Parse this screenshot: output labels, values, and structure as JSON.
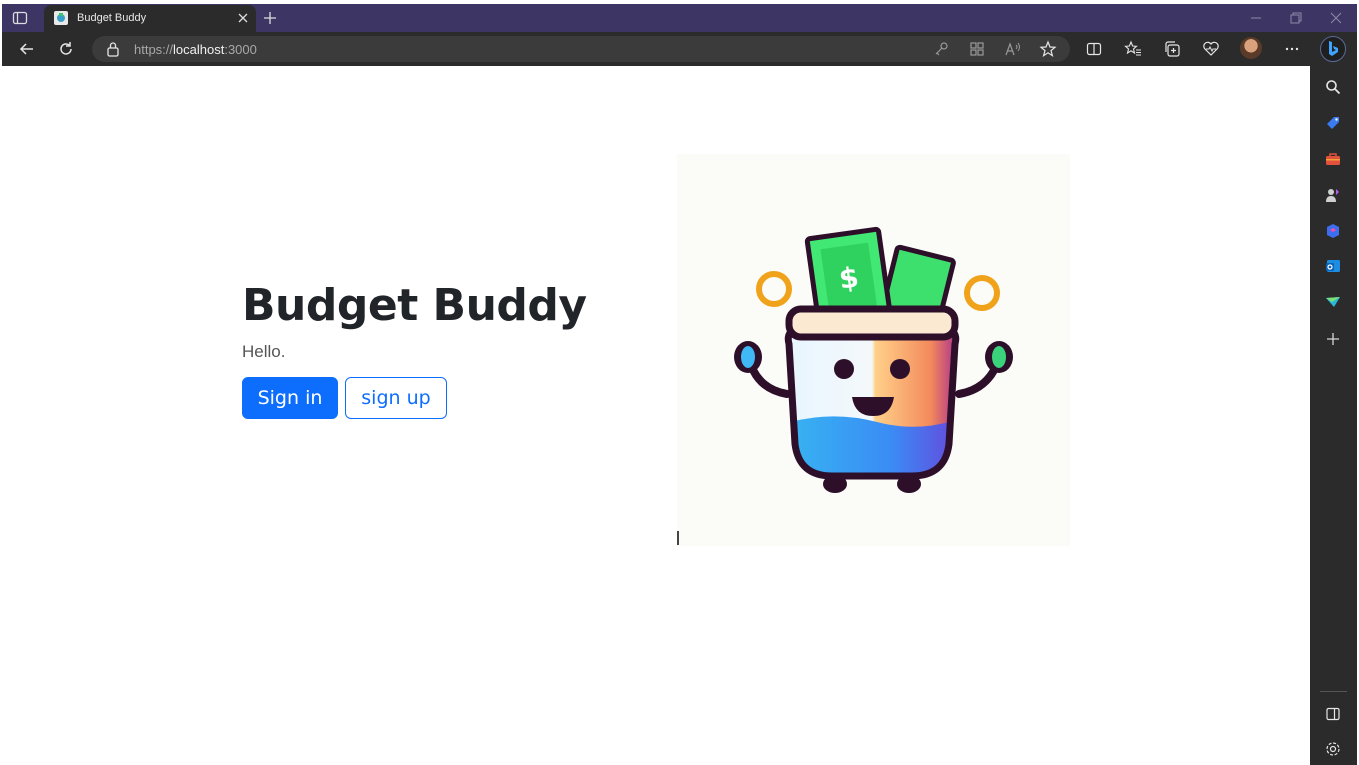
{
  "browser": {
    "tab_title": "Budget Buddy",
    "url_scheme": "https://",
    "url_host": "localhost",
    "url_port": ":3000",
    "theme_color": "#3d3564"
  },
  "page": {
    "title": "Budget Buddy",
    "greeting": "Hello.",
    "sign_in_label": "Sign in",
    "sign_up_label": "sign up",
    "accent_color": "#0d6efd"
  },
  "illustration": {
    "icon": "money-jar-mascot-image",
    "bill_symbol": "$"
  },
  "icons": {
    "toolbar": [
      "back-icon",
      "refresh-icon",
      "lock-icon",
      "key-icon",
      "apps-icon",
      "read-aloud-icon",
      "favorite-star-icon",
      "split-screen-icon",
      "favorites-icon",
      "collections-icon",
      "health-icon",
      "profile-avatar",
      "more-icon",
      "bing-icon"
    ],
    "sidebar": [
      "search-icon",
      "shopping-tag-icon",
      "tools-icon",
      "games-icon",
      "office-icon",
      "outlook-icon",
      "send-icon",
      "add-icon",
      "hide-sidebar-icon",
      "settings-icon"
    ]
  }
}
